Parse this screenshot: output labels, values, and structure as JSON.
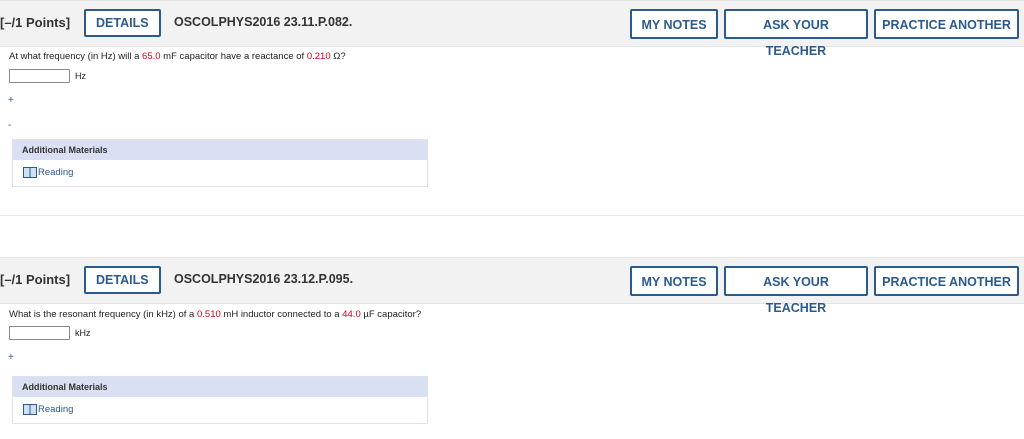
{
  "questions": [
    {
      "points": "[–/1 Points]",
      "details_label": "DETAILS",
      "question_id": "OSCOLPHYS2016 23.11.P.082.",
      "my_notes_label": "MY NOTES",
      "ask_teacher_label": "ASK YOUR TEACHER",
      "practice_label": "PRACTICE ANOTHER",
      "prompt": {
        "part1": "At what frequency (in Hz) will a ",
        "value1": "65.0",
        "part2": " mF capacitor have a reactance of ",
        "value2": "0.210",
        "part3": " Ω?"
      },
      "answer_value": "",
      "unit": "Hz",
      "markers": [
        "+",
        "-"
      ],
      "additional_materials_title": "Additional Materials",
      "reading_label": "Reading"
    },
    {
      "points": "[–/1 Points]",
      "details_label": "DETAILS",
      "question_id": "OSCOLPHYS2016 23.12.P.095.",
      "my_notes_label": "MY NOTES",
      "ask_teacher_label": "ASK YOUR TEACHER",
      "practice_label": "PRACTICE ANOTHER",
      "prompt": {
        "part1": "What is the resonant frequency (in kHz) of a ",
        "value1": "0.510",
        "part2": " mH inductor connected to a ",
        "value2": "44.0",
        "part3": " µF capacitor?"
      },
      "answer_value": "",
      "unit": "kHz",
      "markers": [
        "+"
      ],
      "additional_materials_title": "Additional Materials",
      "reading_label": "Reading"
    }
  ],
  "colors": {
    "accent_blue": "#2b5a8f",
    "value_red": "#d0021b",
    "header_bg": "#f2f2f2",
    "materials_header_bg": "#d9e0f3"
  },
  "icons": {
    "reading": "book-icon"
  }
}
